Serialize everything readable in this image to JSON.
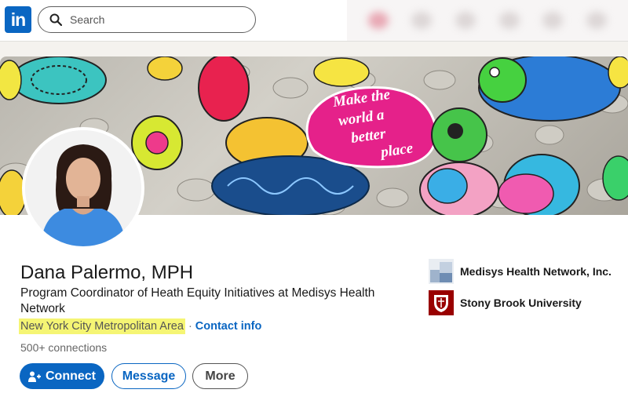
{
  "topbar": {
    "logo_text": "in",
    "search_placeholder": "Search"
  },
  "banner": {
    "stone_text": [
      "Make the",
      "world a",
      "better",
      "place"
    ]
  },
  "profile": {
    "name": "Dana Palermo, MPH",
    "headline": "Program Coordinator of Heath Equity Initiatives at Medisys Health Network",
    "location": "New York City Metropolitan Area",
    "separator": "·",
    "contact_label": "Contact info",
    "connections": "500+ connections"
  },
  "actions": {
    "connect_label": "Connect",
    "message_label": "Message",
    "more_label": "More"
  },
  "orgs": [
    {
      "name": "Medisys Health Network, Inc.",
      "icon": "company-logo-icon"
    },
    {
      "name": "Stony Brook University",
      "icon": "university-logo-icon"
    }
  ],
  "colors": {
    "brand": "#0a66c2",
    "highlight": "#f5f574",
    "stony_brook_red": "#990000"
  }
}
